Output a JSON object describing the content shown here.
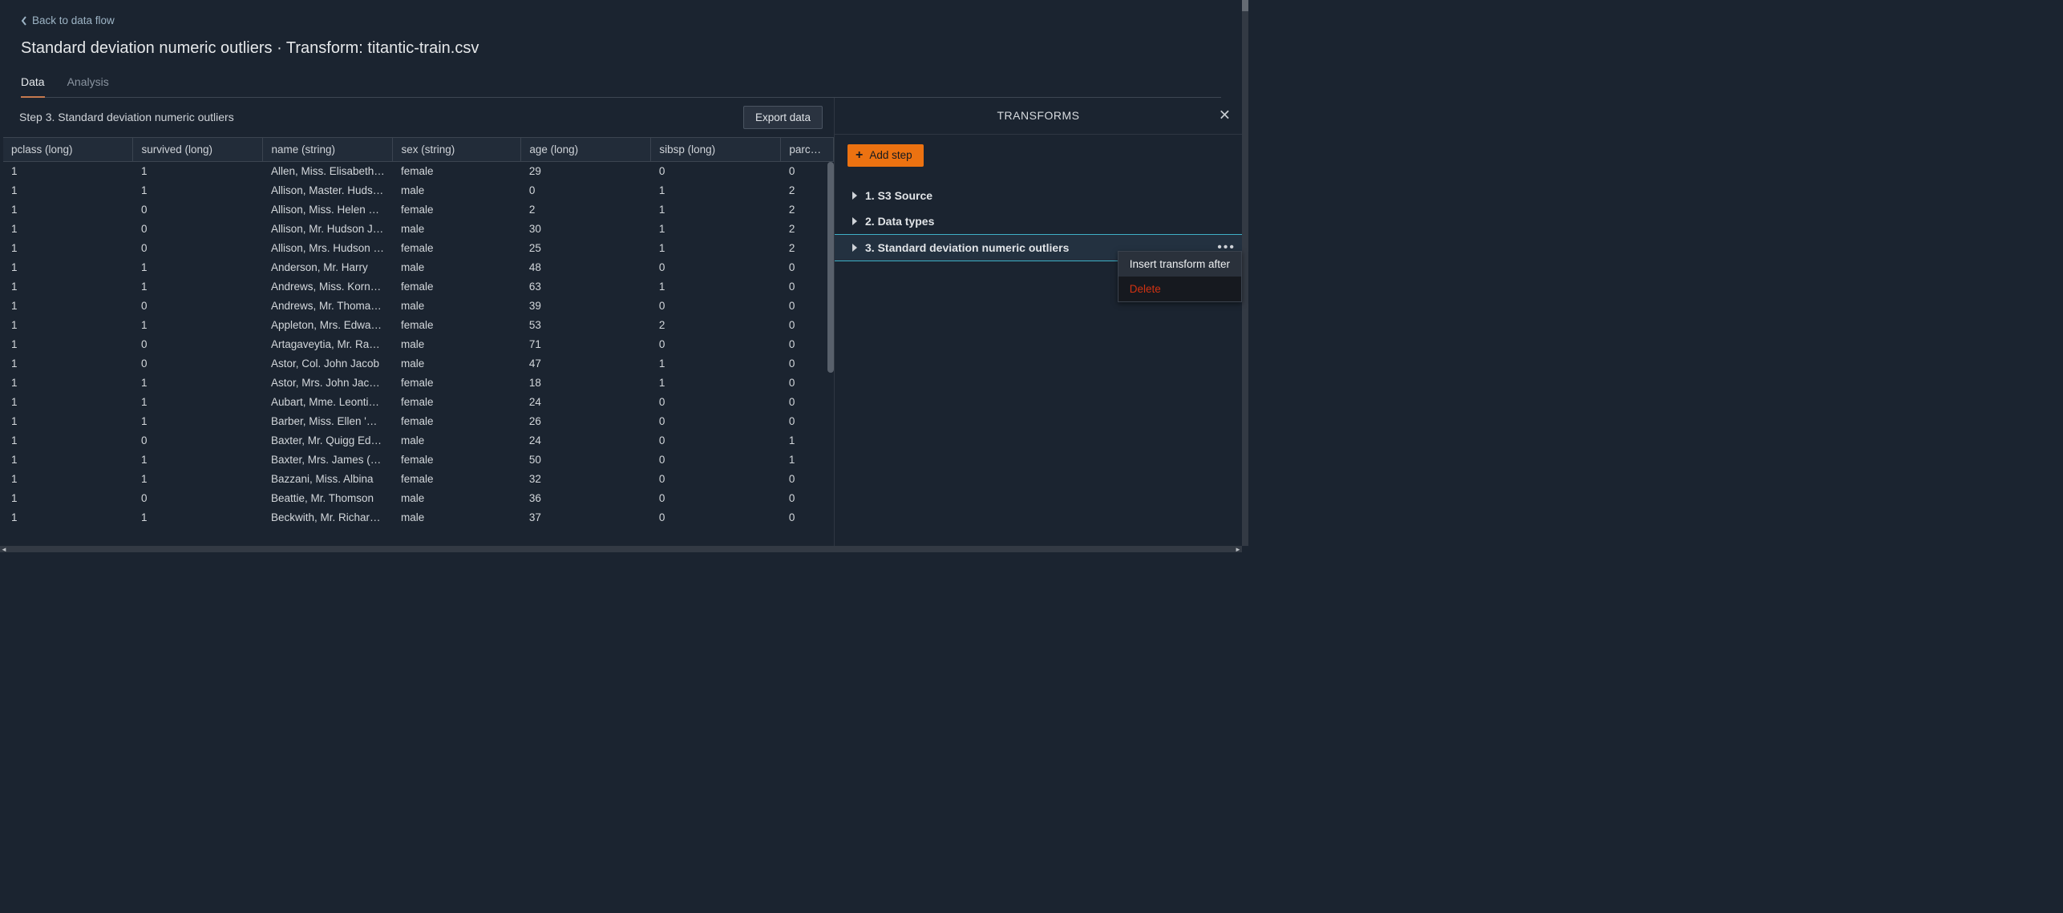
{
  "header": {
    "back_label": "Back to data flow",
    "page_title": "Standard deviation numeric outliers · Transform: titantic-train.csv"
  },
  "tabs": {
    "data": "Data",
    "analysis": "Analysis"
  },
  "step_bar": {
    "label": "Step 3. Standard deviation numeric outliers",
    "export_btn": "Export data"
  },
  "columns": [
    "pclass (long)",
    "survived (long)",
    "name (string)",
    "sex (string)",
    "age (long)",
    "sibsp (long)",
    "parch (long)"
  ],
  "rows": [
    {
      "pclass": "1",
      "survived": "1",
      "name": "Allen, Miss. Elisabeth W…",
      "sex": "female",
      "age": "29",
      "sibsp": "0",
      "parch": "0"
    },
    {
      "pclass": "1",
      "survived": "1",
      "name": "Allison, Master. Hudson…",
      "sex": "male",
      "age": "0",
      "sibsp": "1",
      "parch": "2"
    },
    {
      "pclass": "1",
      "survived": "0",
      "name": "Allison, Miss. Helen Lor…",
      "sex": "female",
      "age": "2",
      "sibsp": "1",
      "parch": "2"
    },
    {
      "pclass": "1",
      "survived": "0",
      "name": "Allison, Mr. Hudson Jos…",
      "sex": "male",
      "age": "30",
      "sibsp": "1",
      "parch": "2"
    },
    {
      "pclass": "1",
      "survived": "0",
      "name": "Allison, Mrs. Hudson J C…",
      "sex": "female",
      "age": "25",
      "sibsp": "1",
      "parch": "2"
    },
    {
      "pclass": "1",
      "survived": "1",
      "name": "Anderson, Mr. Harry",
      "sex": "male",
      "age": "48",
      "sibsp": "0",
      "parch": "0"
    },
    {
      "pclass": "1",
      "survived": "1",
      "name": "Andrews, Miss. Kornelia…",
      "sex": "female",
      "age": "63",
      "sibsp": "1",
      "parch": "0"
    },
    {
      "pclass": "1",
      "survived": "0",
      "name": "Andrews, Mr. Thomas Jr",
      "sex": "male",
      "age": "39",
      "sibsp": "0",
      "parch": "0"
    },
    {
      "pclass": "1",
      "survived": "1",
      "name": "Appleton, Mrs. Edward …",
      "sex": "female",
      "age": "53",
      "sibsp": "2",
      "parch": "0"
    },
    {
      "pclass": "1",
      "survived": "0",
      "name": "Artagaveytia, Mr. Ramon",
      "sex": "male",
      "age": "71",
      "sibsp": "0",
      "parch": "0"
    },
    {
      "pclass": "1",
      "survived": "0",
      "name": "Astor, Col. John Jacob",
      "sex": "male",
      "age": "47",
      "sibsp": "1",
      "parch": "0"
    },
    {
      "pclass": "1",
      "survived": "1",
      "name": "Astor, Mrs. John Jacob (…",
      "sex": "female",
      "age": "18",
      "sibsp": "1",
      "parch": "0"
    },
    {
      "pclass": "1",
      "survived": "1",
      "name": "Aubart, Mme. Leontine …",
      "sex": "female",
      "age": "24",
      "sibsp": "0",
      "parch": "0"
    },
    {
      "pclass": "1",
      "survived": "1",
      "name": "Barber, Miss. Ellen 'Nellie'",
      "sex": "female",
      "age": "26",
      "sibsp": "0",
      "parch": "0"
    },
    {
      "pclass": "1",
      "survived": "0",
      "name": "Baxter, Mr. Quigg Edmo…",
      "sex": "male",
      "age": "24",
      "sibsp": "0",
      "parch": "1"
    },
    {
      "pclass": "1",
      "survived": "1",
      "name": "Baxter, Mrs. James (Hel…",
      "sex": "female",
      "age": "50",
      "sibsp": "0",
      "parch": "1"
    },
    {
      "pclass": "1",
      "survived": "1",
      "name": "Bazzani, Miss. Albina",
      "sex": "female",
      "age": "32",
      "sibsp": "0",
      "parch": "0"
    },
    {
      "pclass": "1",
      "survived": "0",
      "name": "Beattie, Mr. Thomson",
      "sex": "male",
      "age": "36",
      "sibsp": "0",
      "parch": "0"
    },
    {
      "pclass": "1",
      "survived": "1",
      "name": "Beckwith, Mr. Richard L…",
      "sex": "male",
      "age": "37",
      "sibsp": "0",
      "parch": "0"
    }
  ],
  "right": {
    "title": "TRANSFORMS",
    "add_step": "Add step",
    "steps": [
      "1. S3 Source",
      "2. Data types",
      "3. Standard deviation numeric outliers"
    ],
    "menu": {
      "insert": "Insert transform after",
      "delete": "Delete"
    }
  }
}
